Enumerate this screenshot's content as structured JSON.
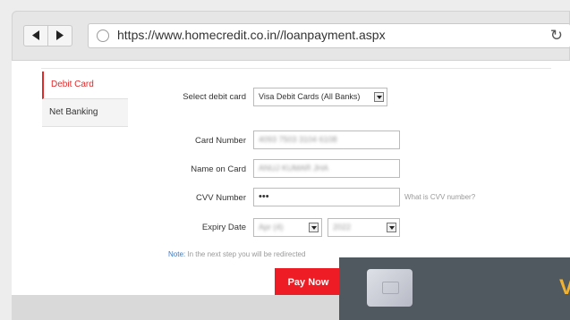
{
  "browser": {
    "url": "https://www.homecredit.co.in//loanpayment.aspx"
  },
  "tabs": [
    {
      "label": "Debit Card",
      "active": true
    },
    {
      "label": "Net Banking",
      "active": false
    }
  ],
  "form": {
    "select_debit_card_label": "Select debit card",
    "select_debit_card_value": "Visa Debit Cards (All Banks)",
    "card_number_label": "Card Number",
    "card_number_value": "4093 7503 3104 6108",
    "name_on_card_label": "Name on Card",
    "name_on_card_value": "ANUJ KUMAR JHA",
    "cvv_label": "CVV Number",
    "cvv_value": "•••",
    "cvv_help": "What is CVV number?",
    "expiry_label": "Expiry Date",
    "expiry_month": "Apr (4)",
    "expiry_year": "2022"
  },
  "note": {
    "label": "Note:",
    "text": "In the next step you will be redirected"
  },
  "pay_button": "Pay Now",
  "overlay": {
    "logo_fragment": "V"
  },
  "colors": {
    "accent_red": "#ee1c24",
    "note_blue": "#3a78c9",
    "overlay_bg": "#505960"
  }
}
